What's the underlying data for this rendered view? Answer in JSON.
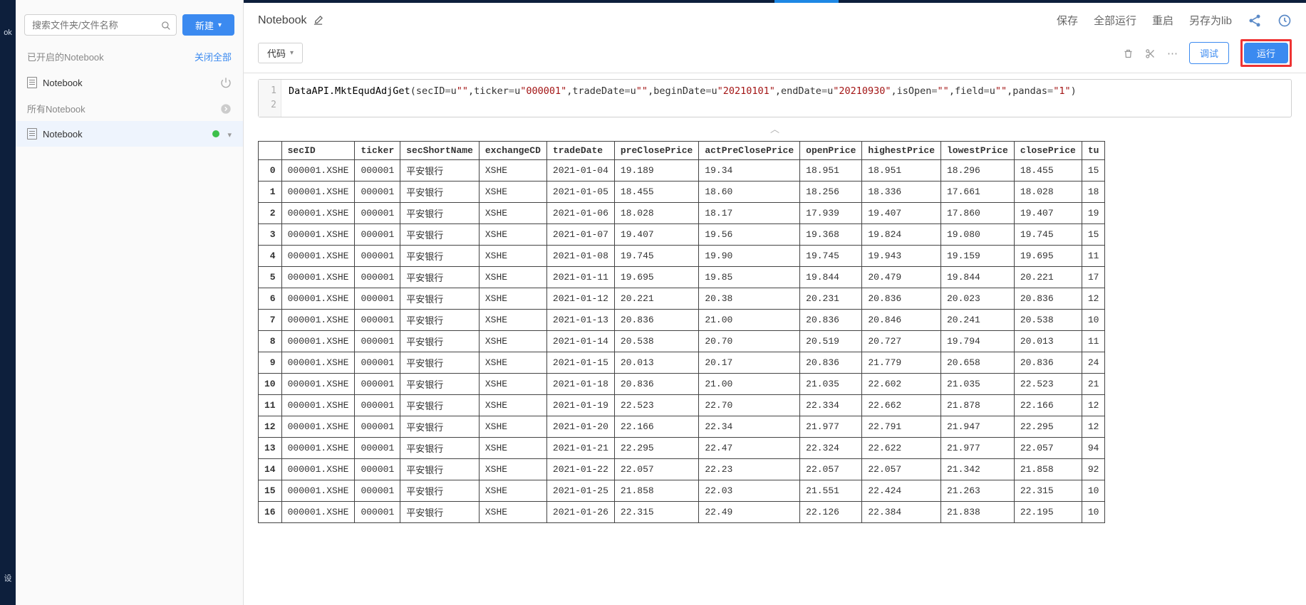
{
  "sidebar": {
    "search_placeholder": "搜索文件夹/文件名称",
    "new_button": "新建",
    "opened_header": "已开启的Notebook",
    "close_all": "关闭全部",
    "opened_items": [
      {
        "label": "Notebook"
      }
    ],
    "all_header": "所有Notebook",
    "all_items": [
      {
        "label": "Notebook"
      }
    ]
  },
  "rail": {
    "item1": "ok",
    "item2": "设"
  },
  "header": {
    "title": "Notebook",
    "save": "保存",
    "run_all": "全部运行",
    "restart": "重启",
    "save_as_lib": "另存为lib"
  },
  "toolbar": {
    "cell_type": "代码",
    "debug": "调试",
    "run": "运行"
  },
  "code": {
    "line1": {
      "func": "DataAPI.MktEqudAdjGet",
      "args_plain": [
        "secID=u",
        "\"\"",
        ",ticker=u",
        "\"000001\"",
        ",tradeDate=u",
        "\"\"",
        ",beginDate=u",
        "\"20210101\"",
        ",endDate=u",
        "\"20210930\"",
        ",isOpen=",
        "\"\"",
        ",field=u",
        "\"\"",
        ",pandas=",
        "\"1\"",
        ")"
      ]
    },
    "line_numbers": [
      "1",
      "2"
    ]
  },
  "table": {
    "columns": [
      "secID",
      "ticker",
      "secShortName",
      "exchangeCD",
      "tradeDate",
      "preClosePrice",
      "actPreClosePrice",
      "openPrice",
      "highestPrice",
      "lowestPrice",
      "closePrice",
      "tu"
    ],
    "rows": [
      {
        "idx": "0",
        "secID": "000001.XSHE",
        "ticker": "000001",
        "secShortName": "平安银行",
        "exchangeCD": "XSHE",
        "tradeDate": "2021-01-04",
        "preClosePrice": "19.189",
        "actPreClosePrice": "19.34",
        "openPrice": "18.951",
        "highestPrice": "18.951",
        "lowestPrice": "18.296",
        "closePrice": "18.455",
        "tu": "15"
      },
      {
        "idx": "1",
        "secID": "000001.XSHE",
        "ticker": "000001",
        "secShortName": "平安银行",
        "exchangeCD": "XSHE",
        "tradeDate": "2021-01-05",
        "preClosePrice": "18.455",
        "actPreClosePrice": "18.60",
        "openPrice": "18.256",
        "highestPrice": "18.336",
        "lowestPrice": "17.661",
        "closePrice": "18.028",
        "tu": "18"
      },
      {
        "idx": "2",
        "secID": "000001.XSHE",
        "ticker": "000001",
        "secShortName": "平安银行",
        "exchangeCD": "XSHE",
        "tradeDate": "2021-01-06",
        "preClosePrice": "18.028",
        "actPreClosePrice": "18.17",
        "openPrice": "17.939",
        "highestPrice": "19.407",
        "lowestPrice": "17.860",
        "closePrice": "19.407",
        "tu": "19"
      },
      {
        "idx": "3",
        "secID": "000001.XSHE",
        "ticker": "000001",
        "secShortName": "平安银行",
        "exchangeCD": "XSHE",
        "tradeDate": "2021-01-07",
        "preClosePrice": "19.407",
        "actPreClosePrice": "19.56",
        "openPrice": "19.368",
        "highestPrice": "19.824",
        "lowestPrice": "19.080",
        "closePrice": "19.745",
        "tu": "15"
      },
      {
        "idx": "4",
        "secID": "000001.XSHE",
        "ticker": "000001",
        "secShortName": "平安银行",
        "exchangeCD": "XSHE",
        "tradeDate": "2021-01-08",
        "preClosePrice": "19.745",
        "actPreClosePrice": "19.90",
        "openPrice": "19.745",
        "highestPrice": "19.943",
        "lowestPrice": "19.159",
        "closePrice": "19.695",
        "tu": "11"
      },
      {
        "idx": "5",
        "secID": "000001.XSHE",
        "ticker": "000001",
        "secShortName": "平安银行",
        "exchangeCD": "XSHE",
        "tradeDate": "2021-01-11",
        "preClosePrice": "19.695",
        "actPreClosePrice": "19.85",
        "openPrice": "19.844",
        "highestPrice": "20.479",
        "lowestPrice": "19.844",
        "closePrice": "20.221",
        "tu": "17"
      },
      {
        "idx": "6",
        "secID": "000001.XSHE",
        "ticker": "000001",
        "secShortName": "平安银行",
        "exchangeCD": "XSHE",
        "tradeDate": "2021-01-12",
        "preClosePrice": "20.221",
        "actPreClosePrice": "20.38",
        "openPrice": "20.231",
        "highestPrice": "20.836",
        "lowestPrice": "20.023",
        "closePrice": "20.836",
        "tu": "12"
      },
      {
        "idx": "7",
        "secID": "000001.XSHE",
        "ticker": "000001",
        "secShortName": "平安银行",
        "exchangeCD": "XSHE",
        "tradeDate": "2021-01-13",
        "preClosePrice": "20.836",
        "actPreClosePrice": "21.00",
        "openPrice": "20.836",
        "highestPrice": "20.846",
        "lowestPrice": "20.241",
        "closePrice": "20.538",
        "tu": "10"
      },
      {
        "idx": "8",
        "secID": "000001.XSHE",
        "ticker": "000001",
        "secShortName": "平安银行",
        "exchangeCD": "XSHE",
        "tradeDate": "2021-01-14",
        "preClosePrice": "20.538",
        "actPreClosePrice": "20.70",
        "openPrice": "20.519",
        "highestPrice": "20.727",
        "lowestPrice": "19.794",
        "closePrice": "20.013",
        "tu": "11"
      },
      {
        "idx": "9",
        "secID": "000001.XSHE",
        "ticker": "000001",
        "secShortName": "平安银行",
        "exchangeCD": "XSHE",
        "tradeDate": "2021-01-15",
        "preClosePrice": "20.013",
        "actPreClosePrice": "20.17",
        "openPrice": "20.836",
        "highestPrice": "21.779",
        "lowestPrice": "20.658",
        "closePrice": "20.836",
        "tu": "24"
      },
      {
        "idx": "10",
        "secID": "000001.XSHE",
        "ticker": "000001",
        "secShortName": "平安银行",
        "exchangeCD": "XSHE",
        "tradeDate": "2021-01-18",
        "preClosePrice": "20.836",
        "actPreClosePrice": "21.00",
        "openPrice": "21.035",
        "highestPrice": "22.602",
        "lowestPrice": "21.035",
        "closePrice": "22.523",
        "tu": "21"
      },
      {
        "idx": "11",
        "secID": "000001.XSHE",
        "ticker": "000001",
        "secShortName": "平安银行",
        "exchangeCD": "XSHE",
        "tradeDate": "2021-01-19",
        "preClosePrice": "22.523",
        "actPreClosePrice": "22.70",
        "openPrice": "22.334",
        "highestPrice": "22.662",
        "lowestPrice": "21.878",
        "closePrice": "22.166",
        "tu": "12"
      },
      {
        "idx": "12",
        "secID": "000001.XSHE",
        "ticker": "000001",
        "secShortName": "平安银行",
        "exchangeCD": "XSHE",
        "tradeDate": "2021-01-20",
        "preClosePrice": "22.166",
        "actPreClosePrice": "22.34",
        "openPrice": "21.977",
        "highestPrice": "22.791",
        "lowestPrice": "21.947",
        "closePrice": "22.295",
        "tu": "12"
      },
      {
        "idx": "13",
        "secID": "000001.XSHE",
        "ticker": "000001",
        "secShortName": "平安银行",
        "exchangeCD": "XSHE",
        "tradeDate": "2021-01-21",
        "preClosePrice": "22.295",
        "actPreClosePrice": "22.47",
        "openPrice": "22.324",
        "highestPrice": "22.622",
        "lowestPrice": "21.977",
        "closePrice": "22.057",
        "tu": "94"
      },
      {
        "idx": "14",
        "secID": "000001.XSHE",
        "ticker": "000001",
        "secShortName": "平安银行",
        "exchangeCD": "XSHE",
        "tradeDate": "2021-01-22",
        "preClosePrice": "22.057",
        "actPreClosePrice": "22.23",
        "openPrice": "22.057",
        "highestPrice": "22.057",
        "lowestPrice": "21.342",
        "closePrice": "21.858",
        "tu": "92"
      },
      {
        "idx": "15",
        "secID": "000001.XSHE",
        "ticker": "000001",
        "secShortName": "平安银行",
        "exchangeCD": "XSHE",
        "tradeDate": "2021-01-25",
        "preClosePrice": "21.858",
        "actPreClosePrice": "22.03",
        "openPrice": "21.551",
        "highestPrice": "22.424",
        "lowestPrice": "21.263",
        "closePrice": "22.315",
        "tu": "10"
      },
      {
        "idx": "16",
        "secID": "000001.XSHE",
        "ticker": "000001",
        "secShortName": "平安银行",
        "exchangeCD": "XSHE",
        "tradeDate": "2021-01-26",
        "preClosePrice": "22.315",
        "actPreClosePrice": "22.49",
        "openPrice": "22.126",
        "highestPrice": "22.384",
        "lowestPrice": "21.838",
        "closePrice": "22.195",
        "tu": "10"
      }
    ]
  }
}
